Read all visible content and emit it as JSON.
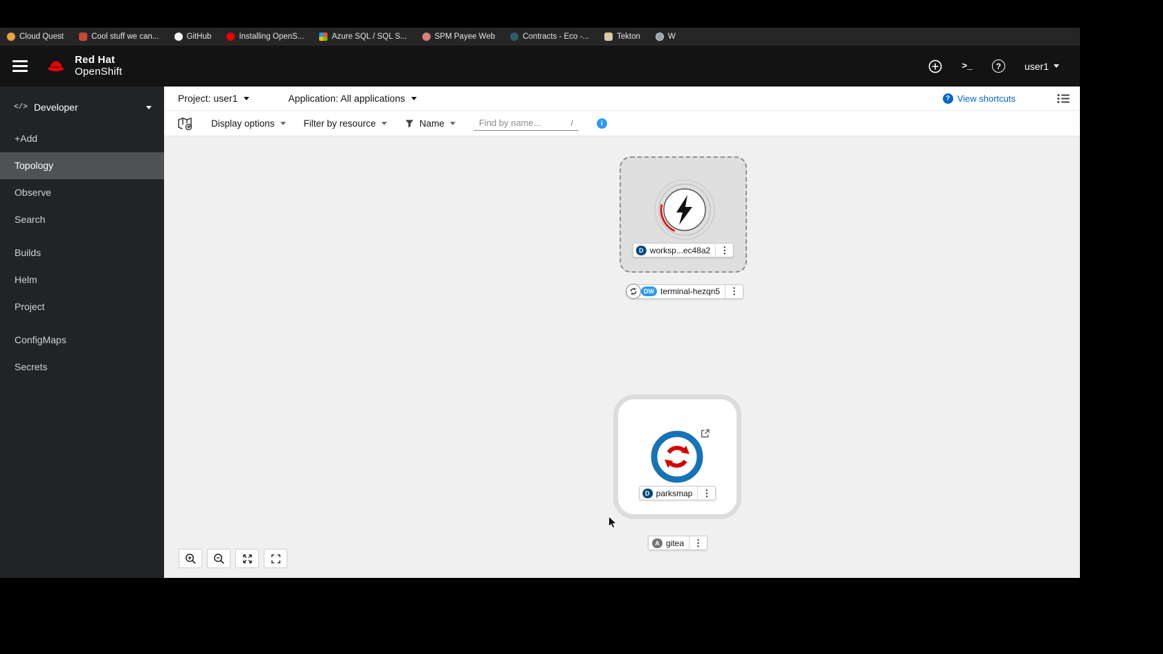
{
  "colors": {
    "accent_blue": "#0066cc",
    "brand_red": "#ee0000",
    "info_blue": "#2b9af3",
    "badge_deployment": "#00487a",
    "badge_devworkspace": "#2b9af3",
    "badge_application": "#72767b",
    "masthead_bg": "#131313",
    "sidebar_bg": "#212427",
    "sidebar_selected_bg": "#4f5255",
    "canvas_bg": "#f0f0f0"
  },
  "icons": {
    "kebab": "⋮",
    "help": "?",
    "terminal_prompt": ">_",
    "info": "i",
    "question": "?",
    "code": "</>"
  },
  "bookmarks_bar": {
    "items": [
      {
        "label": "Cloud Quest",
        "icon": "cloud-quest-favicon"
      },
      {
        "label": "Cool stuff we can...",
        "icon": "folder-favicon"
      },
      {
        "label": "GitHub",
        "icon": "github-favicon"
      },
      {
        "label": "Installing OpenS...",
        "icon": "openshift-favicon"
      },
      {
        "label": "Azure SQL / SQL S...",
        "icon": "azure-favicon"
      },
      {
        "label": "SPM Payee Web",
        "icon": "spm-favicon"
      },
      {
        "label": "Contracts - Eco -...",
        "icon": "contracts-favicon"
      },
      {
        "label": "Tekton",
        "icon": "tekton-favicon"
      },
      {
        "label": "W",
        "icon": "globe-favicon"
      }
    ]
  },
  "masthead": {
    "brand_line1": "Red Hat",
    "brand_line2": "OpenShift",
    "user": "user1"
  },
  "sidebar": {
    "perspective": "Developer",
    "items": [
      {
        "label": "+Add"
      },
      {
        "label": "Topology",
        "selected": true
      },
      {
        "label": "Observe"
      },
      {
        "label": "Search"
      },
      {
        "label": "Builds"
      },
      {
        "label": "Helm"
      },
      {
        "label": "Project"
      },
      {
        "label": "ConfigMaps"
      },
      {
        "label": "Secrets"
      }
    ]
  },
  "context_bar": {
    "project": "Project: user1",
    "application": "Application: All applications",
    "view_shortcuts": "View shortcuts"
  },
  "toolbar": {
    "display_options": "Display options",
    "filter_by_resource": "Filter by resource",
    "name_filter": "Name",
    "find_placeholder": "Find by name...",
    "shortcut_hint": "/"
  },
  "topology": {
    "workspace_node": {
      "badge": "D",
      "label": "worksp...ec48a2"
    },
    "terminal_pill": {
      "badge": "DW",
      "label": "terminal-hezqn5"
    },
    "parksmap_node": {
      "badge": "D",
      "label": "parksmap"
    },
    "gitea_pill": {
      "badge": "A",
      "label": "gitea"
    }
  }
}
